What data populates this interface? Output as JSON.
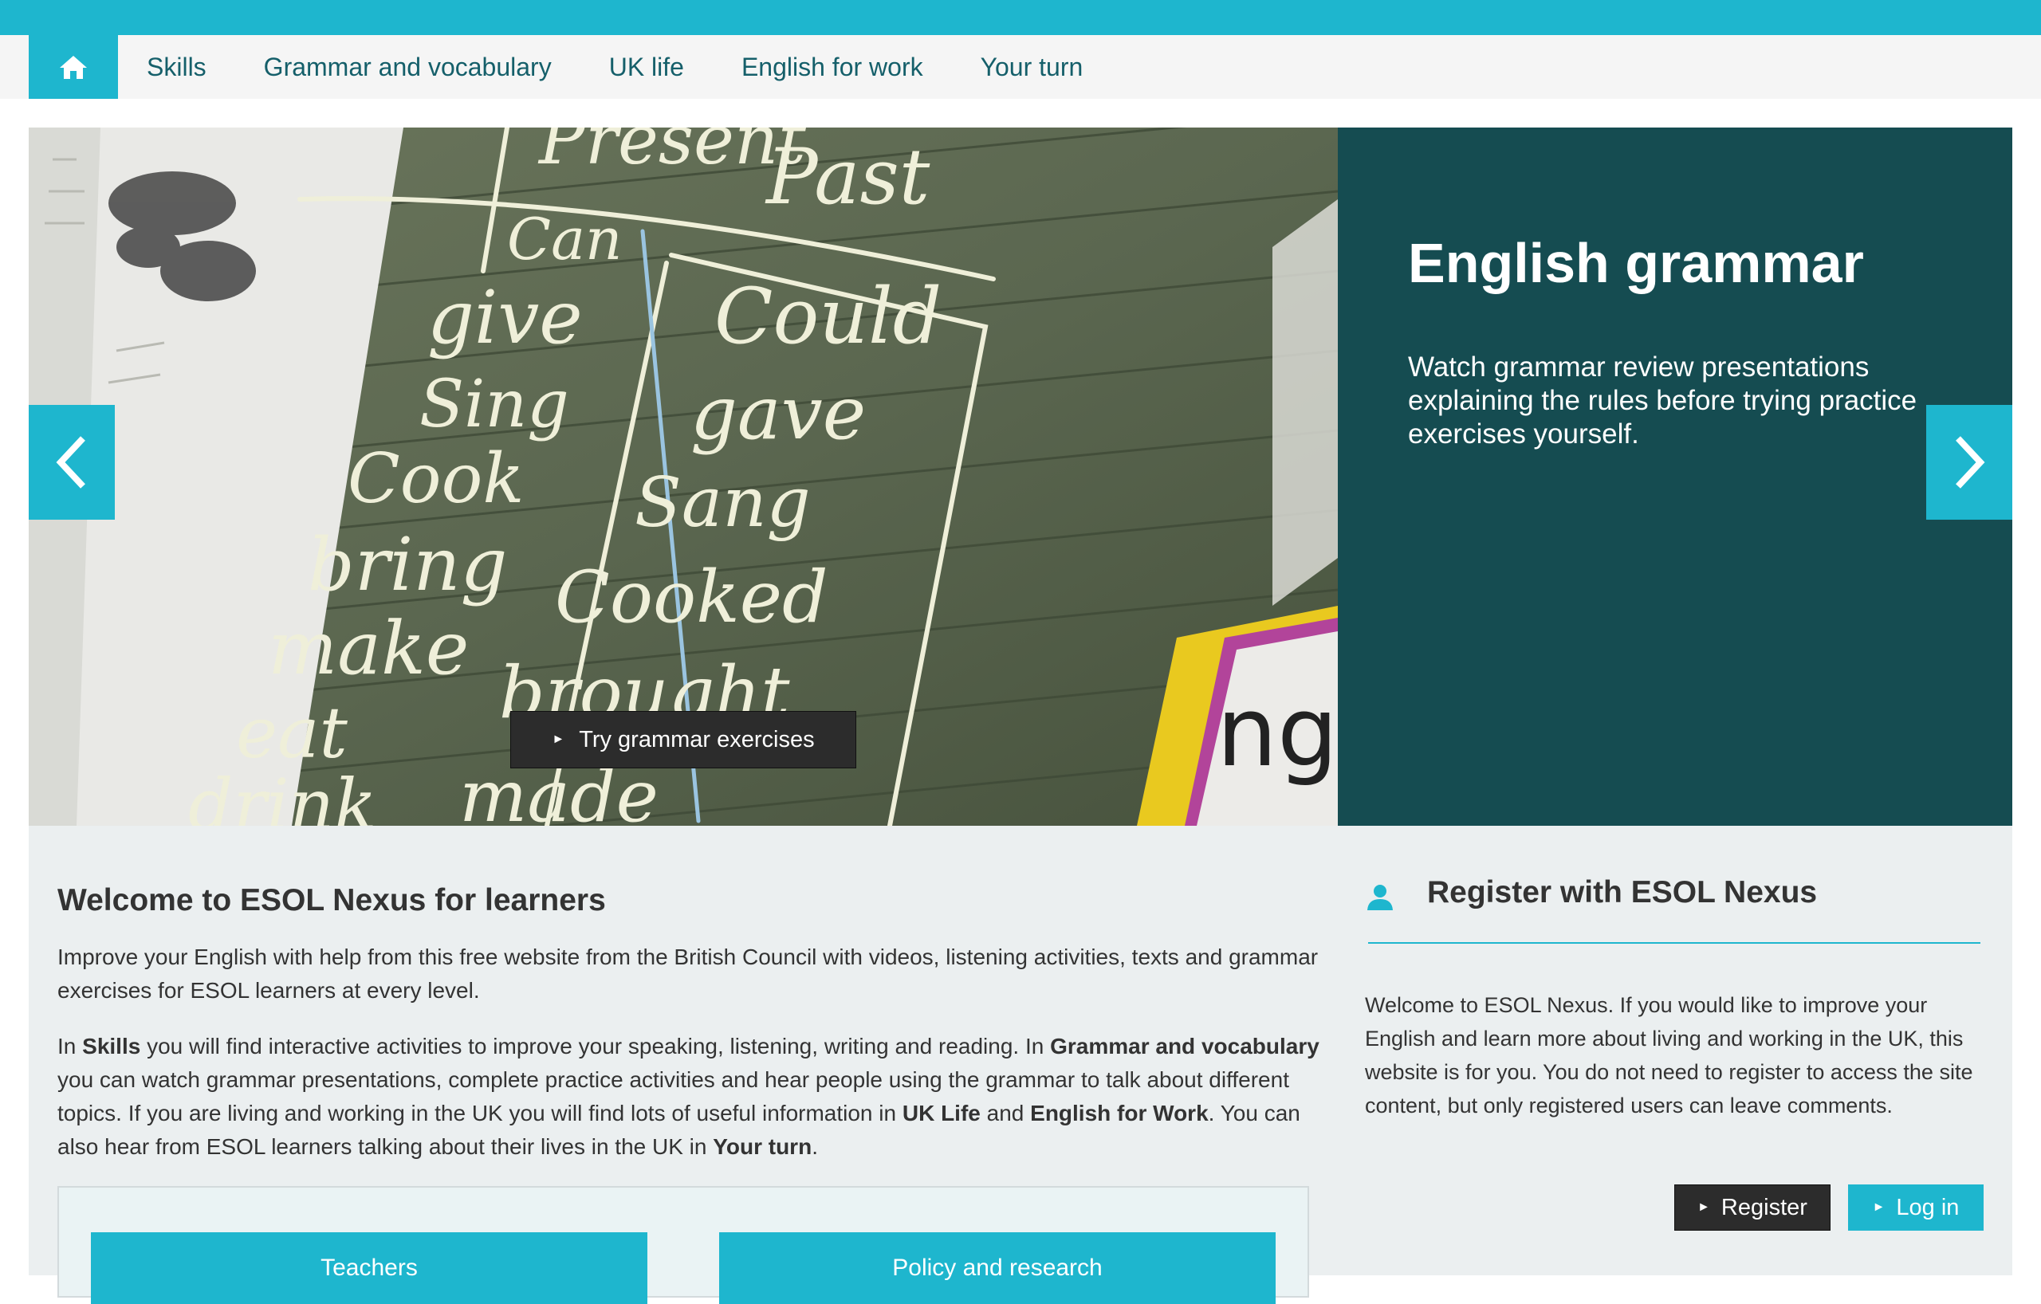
{
  "colors": {
    "accent": "#1eb6ce",
    "nav_text": "#155f6a",
    "hero_panel": "#154c51",
    "dark_button": "#2c2c2c",
    "content_bg": "#ebeff0"
  },
  "nav": {
    "home_icon": "home-icon",
    "items": [
      "Skills",
      "Grammar and vocabulary",
      "UK life",
      "English for work",
      "Your turn"
    ]
  },
  "hero": {
    "chalk_words": [
      "Present",
      "Past",
      "Can",
      "give",
      "Sing",
      "Cook",
      "bring",
      "make",
      "eat",
      "drink",
      "Could",
      "gave",
      "Sang",
      "Cooked",
      "brought",
      "made",
      "ng"
    ],
    "title": "English grammar",
    "description": "Watch grammar review presentations explaining the rules before trying practice exercises yourself.",
    "button_label": "Try grammar exercises",
    "slide_count": 4,
    "active_slide": 3
  },
  "welcome": {
    "title": "Welcome to ESOL Nexus for learners",
    "intro": "Improve your English with help from this free website from the British Council with videos, listening activities, texts and grammar exercises for ESOL learners at every level.",
    "p2": {
      "t1": "In ",
      "b1": "Skills",
      "t2": " you will find interactive activities to improve your speaking, listening, writing and reading. In ",
      "b2": "Grammar and vocabulary",
      "t3": " you can watch grammar presentations, complete practice activities and hear people using the grammar to talk about different topics. If you are living and working in the UK you will find lots of useful information in ",
      "b3": "UK Life",
      "t4": " and ",
      "b4": "English for Work",
      "t5": ". You can also hear from ESOL learners talking about their lives in the UK in ",
      "b5": "Your turn",
      "t6": "."
    },
    "cards": [
      "Teachers",
      "Policy and research"
    ]
  },
  "register": {
    "icon": "user-icon",
    "title": "Register with ESOL Nexus",
    "text": "Welcome to ESOL Nexus. If you would like to improve your English and learn more about living and working in the UK, this website is for you. You do not need to register to access the site content, but only registered users can leave comments.",
    "register_label": "Register",
    "login_label": "Log in"
  }
}
